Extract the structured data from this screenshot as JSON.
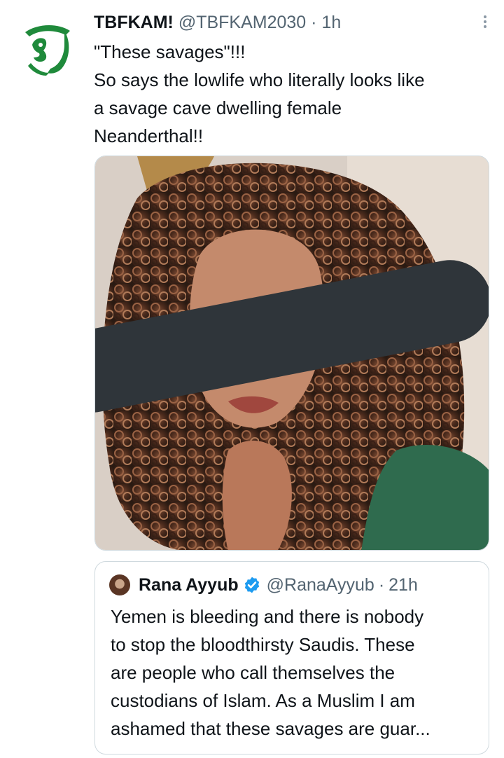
{
  "tweet": {
    "author_name": "TBFKAM!",
    "author_handle": "@TBFKAM2030",
    "separator": "·",
    "time": "1h",
    "more_icon": "more-vertical-icon",
    "avatar_icon": "green-emblem-logo",
    "text_lines": [
      "\"These savages\"!!!",
      "So says the lowlife who literally looks like",
      "a savage cave dwelling female",
      "Neanderthal!!"
    ],
    "media": {
      "description_icon": "photo-with-redaction-bar",
      "redaction_color": "#2f353a"
    }
  },
  "quoted_tweet": {
    "author_name": "Rana Ayyub",
    "verified_icon": "verified-badge-icon",
    "verified_color": "#1d9bf0",
    "author_handle": "@RanaAyyub",
    "separator": "·",
    "time": "21h",
    "text_lines": [
      "Yemen is bleeding and there is nobody",
      "to stop the bloodthirsty Saudis. These",
      "are people who call themselves the",
      "custodians of Islam. As a Muslim I am",
      "ashamed that these savages are guar..."
    ]
  },
  "colors": {
    "text_primary": "#0f1419",
    "text_secondary": "#536471",
    "border": "#cfd9de",
    "logo_green": "#1f8a3b"
  }
}
